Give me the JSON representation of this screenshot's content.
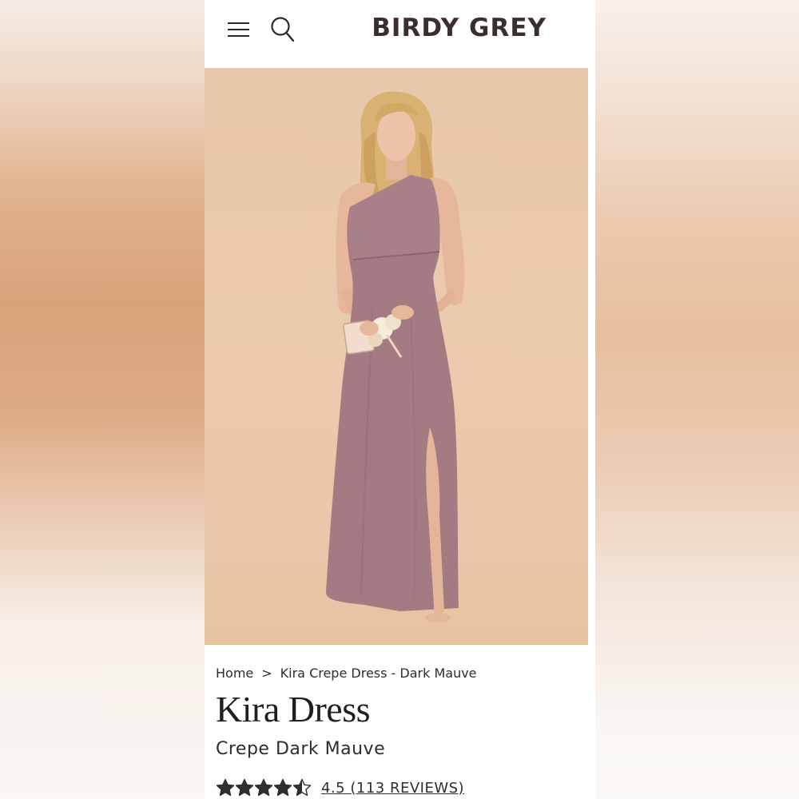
{
  "header": {
    "brand": "BIRDY GREY",
    "menu_icon": "hamburger-menu-icon",
    "search_icon": "search-icon"
  },
  "breadcrumb": {
    "home": "Home",
    "separator": ">",
    "current": "Kira Crepe Dress - Dark Mauve"
  },
  "product": {
    "title": "Kira Dress",
    "subtitle": "Crepe Dark Mauve",
    "rating": 4.5,
    "rating_label": "4.5 (113 REVIEWS)",
    "stars_filled": 4.5,
    "stars_total": 5
  },
  "colors": {
    "dress": "#a47a83",
    "backdrop": "#ebcaae",
    "text": "#2d2d2d",
    "star": "#2f2f2f"
  }
}
